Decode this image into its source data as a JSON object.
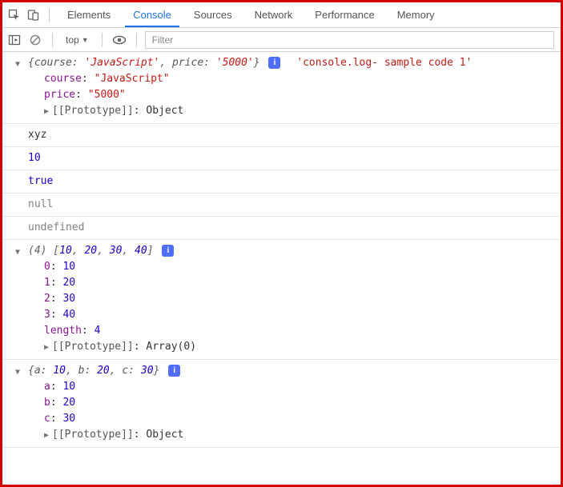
{
  "tabs": [
    "Elements",
    "Console",
    "Sources",
    "Network",
    "Performance",
    "Memory"
  ],
  "activeTab": "Console",
  "toolbar": {
    "context": "top",
    "filterPlaceholder": "Filter"
  },
  "info_glyph": "i",
  "proto_label": "[[Prototype]]",
  "length_label": "length",
  "logs": [
    {
      "kind": "object",
      "summary": "{course: 'JavaScript', price: '5000'}",
      "message": "'console.log- sample code 1'",
      "props": [
        {
          "k": "course",
          "v": "\"JavaScript\"",
          "t": "str"
        },
        {
          "k": "price",
          "v": "\"5000\"",
          "t": "str"
        }
      ],
      "proto": "Object"
    },
    {
      "kind": "string",
      "text": "xyz"
    },
    {
      "kind": "number",
      "text": "10"
    },
    {
      "kind": "bool",
      "text": "true"
    },
    {
      "kind": "null",
      "text": "null"
    },
    {
      "kind": "undef",
      "text": "undefined"
    },
    {
      "kind": "array",
      "summary": "(4) [10, 20, 30, 40]",
      "items": [
        {
          "k": "0",
          "v": "10"
        },
        {
          "k": "1",
          "v": "20"
        },
        {
          "k": "2",
          "v": "30"
        },
        {
          "k": "3",
          "v": "40"
        }
      ],
      "length": "4",
      "proto": "Array(0)"
    },
    {
      "kind": "object",
      "summary": "{a: 10, b: 20, c: 30}",
      "props": [
        {
          "k": "a",
          "v": "10",
          "t": "num"
        },
        {
          "k": "b",
          "v": "20",
          "t": "num"
        },
        {
          "k": "c",
          "v": "30",
          "t": "num"
        }
      ],
      "proto": "Object"
    }
  ],
  "chart_data": null
}
